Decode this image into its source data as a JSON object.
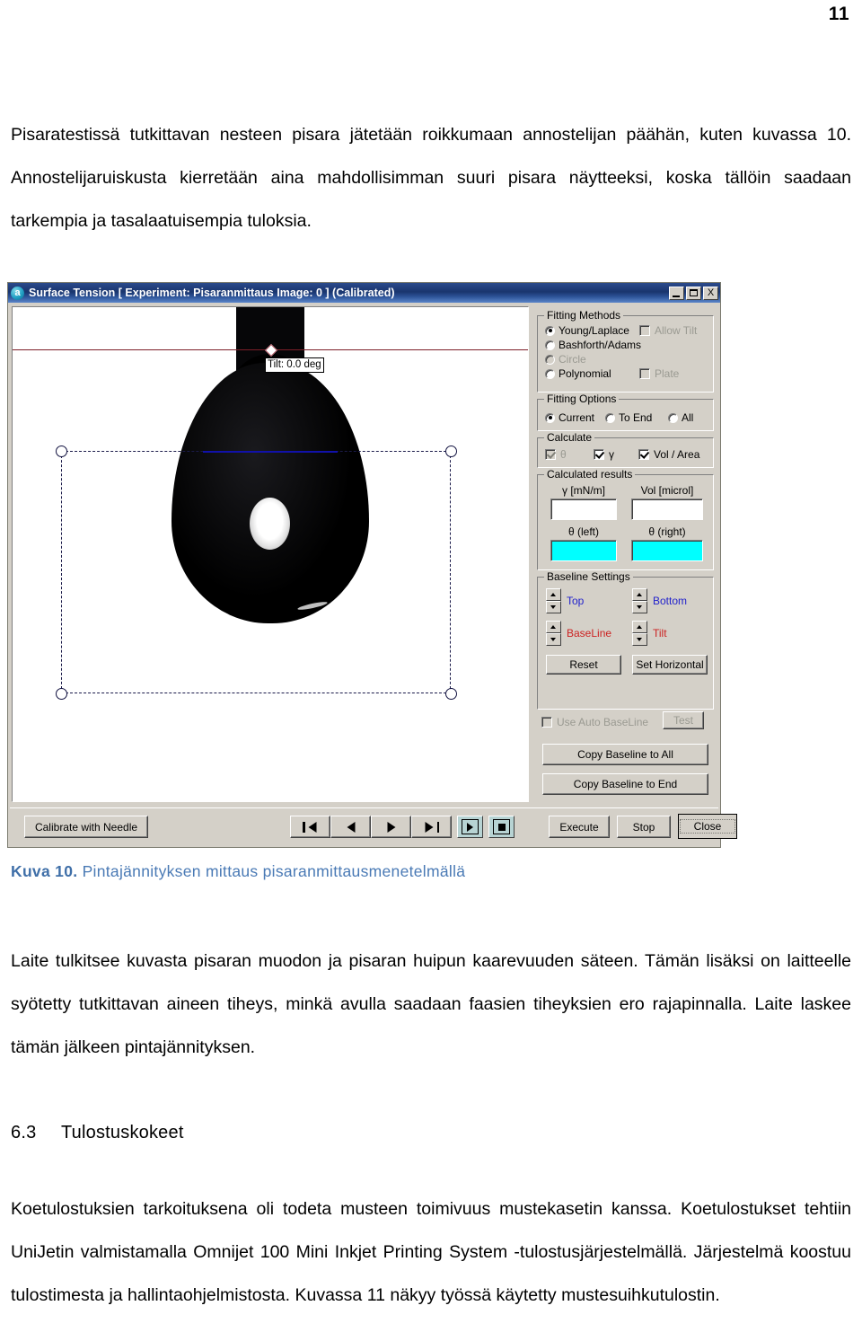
{
  "document": {
    "page_number": "11",
    "paragraphs": {
      "intro": "Pisaratestissä tutkittavan nesteen pisara jätetään roikkumaan annostelijan päähän, kuten kuvassa 10. Annostelijaruiskusta kierretään aina mahdollisimman suuri pisara näytteeksi, koska tällöin saadaan tarkempia ja tasalaatuisempia tuloksia.",
      "device": "Laite tulkitsee kuvasta pisaran muodon ja pisaran huipun kaarevuuden säteen. Tämän lisäksi on laitteelle syötetty tutkittavan aineen tiheys, minkä avulla saadaan faasien tiheyksien ero rajapinnalla. Laite laskee tämän jälkeen pintajännityksen.",
      "print": "Koetulostuksien tarkoituksena oli todeta musteen toimivuus mustekasetin kanssa. Koetulostukset tehtiin UniJetin valmistamalla Omnijet 100 Mini Inkjet Printing System -tulostusjärjestelmällä. Järjestelmä koostuu tulostimesta ja hallintaohjelmistosta. Kuvassa 11 näkyy työssä käytetty mustesuihkutulostin."
    },
    "figure_caption": {
      "label": "Kuva 10.",
      "text": "Pintajännityksen mittaus pisaranmittausmenetelmällä",
      "color": "#4a7ab5"
    },
    "section": {
      "number": "6.3",
      "title": "Tulostuskokeet"
    }
  },
  "app": {
    "title": "Surface Tension [ Experiment: Pisaranmittaus  Image: 0 ]  (Calibrated)",
    "icon_letter": "a",
    "title_buttons": {
      "minimize": "_",
      "maximize": "□",
      "close": "X"
    },
    "canvas": {
      "tilt_label": "Tilt: 0.0 deg"
    },
    "fitting_methods": {
      "title": "Fitting Methods",
      "options": [
        {
          "label": "Young/Laplace",
          "selected": true,
          "enabled": true
        },
        {
          "label": "Bashforth/Adams",
          "selected": false,
          "enabled": true
        },
        {
          "label": "Circle",
          "selected": false,
          "enabled": false
        },
        {
          "label": "Polynomial",
          "selected": false,
          "enabled": true
        }
      ],
      "allow_tilt": {
        "label": "Allow Tilt",
        "checked": false,
        "enabled": false
      },
      "plate": {
        "label": "Plate",
        "checked": false,
        "enabled": false
      }
    },
    "fitting_options": {
      "title": "Fitting Options",
      "options": [
        {
          "label": "Current",
          "selected": true
        },
        {
          "label": "To End",
          "selected": false
        },
        {
          "label": "All",
          "selected": false
        }
      ]
    },
    "calculate": {
      "title": "Calculate",
      "items": [
        {
          "label": "θ",
          "checked": true,
          "enabled": false
        },
        {
          "label": "γ",
          "checked": true,
          "enabled": true
        },
        {
          "label": "Vol / Area",
          "checked": true,
          "enabled": true
        }
      ]
    },
    "calculated_results": {
      "title": "Calculated results",
      "gamma_label": "γ  [mN/m]",
      "gamma_value": "",
      "vol_label": "Vol [microl]",
      "vol_value": "",
      "theta_left_label": "θ   (left)",
      "theta_left_value": "",
      "theta_right_label": "θ   (right)",
      "theta_right_value": "",
      "theta_field_color": "#00ffff"
    },
    "baseline_settings": {
      "title": "Baseline Settings",
      "spinners": [
        {
          "label": "Top",
          "color": "#2222cc"
        },
        {
          "label": "Bottom",
          "color": "#2222cc"
        },
        {
          "label": "BaseLine",
          "color": "#cc2222"
        },
        {
          "label": "Tilt",
          "color": "#cc2222"
        }
      ],
      "reset_label": "Reset",
      "set_horizontal_label": "Set Horizontal",
      "use_auto_baseline": {
        "label": "Use Auto BaseLine",
        "checked": false,
        "enabled": false
      },
      "test_label": "Test",
      "copy_to_all_label": "Copy Baseline to All",
      "copy_to_end_label": "Copy Baseline to End"
    },
    "toolbar": {
      "calibrate_label": "Calibrate with Needle",
      "nav": [
        {
          "name": "first",
          "icon": "skip-back-icon"
        },
        {
          "name": "previous",
          "icon": "play-back-icon"
        },
        {
          "name": "next",
          "icon": "play-forward-icon"
        },
        {
          "name": "last",
          "icon": "skip-forward-icon"
        }
      ],
      "play_icon": "play-icon",
      "stop_icon": "stop-square-icon",
      "execute_label": "Execute",
      "stop_label": "Stop",
      "close_label": "Close"
    }
  }
}
